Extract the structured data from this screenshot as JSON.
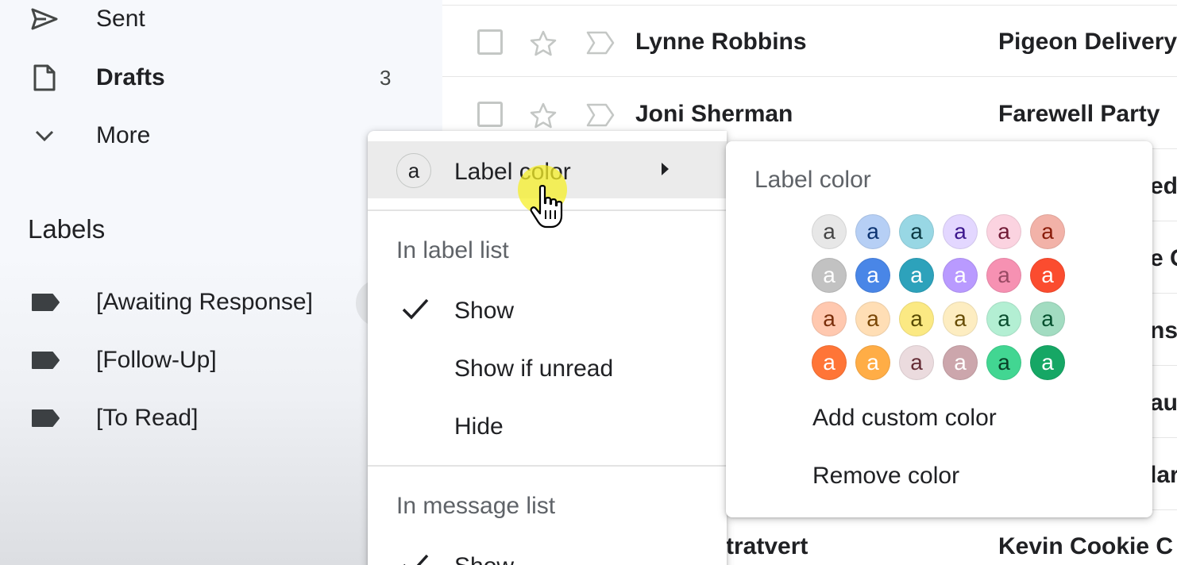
{
  "sidebar": {
    "nav": [
      {
        "label": "Sent",
        "icon": "send-icon",
        "count": ""
      },
      {
        "label": "Drafts",
        "icon": "draft-icon",
        "count": "3"
      },
      {
        "label": "More",
        "icon": "chevron-down-icon",
        "count": ""
      }
    ],
    "labels_heading": "Labels",
    "labels": [
      {
        "label": "[Awaiting Response]",
        "icon": "label-tag-icon"
      },
      {
        "label": "[Follow-Up]",
        "icon": "label-tag-icon"
      },
      {
        "label": "[To Read]",
        "icon": "label-tag-icon"
      }
    ]
  },
  "emails": [
    {
      "sender": "Lynne Robbins",
      "subject": "Pigeon Delivery"
    },
    {
      "sender": "Joni Sherman",
      "subject": "Farewell Party"
    }
  ],
  "email_partials": [
    "ed",
    "e C",
    "ns",
    "au",
    "lar"
  ],
  "email_bottom": {
    "sender_fragment": "tratvert",
    "subject_fragment": "Kevin Cookie C"
  },
  "context_menu": {
    "label_color_item": "Label color",
    "label_color_badge": "a",
    "section_label_list": "In label list",
    "label_list_options": [
      {
        "label": "Show",
        "checked": true
      },
      {
        "label": "Show if unread",
        "checked": false
      },
      {
        "label": "Hide",
        "checked": false
      }
    ],
    "section_message_list": "In message list",
    "message_list_options": [
      {
        "label": "Show",
        "checked": true
      }
    ]
  },
  "label_color_submenu": {
    "title": "Label color",
    "swatch_letter": "a",
    "swatches": [
      {
        "bg": "#e7e7e7",
        "fg": "#464646"
      },
      {
        "bg": "#b6cff5",
        "fg": "#0d3472"
      },
      {
        "bg": "#98d7e4",
        "fg": "#0d3b44"
      },
      {
        "bg": "#e3d7ff",
        "fg": "#3d188e"
      },
      {
        "bg": "#fbd3e0",
        "fg": "#711a36"
      },
      {
        "bg": "#f2b2a8",
        "fg": "#8a1c0a"
      },
      {
        "bg": "#c2c2c2",
        "fg": "#ffffff"
      },
      {
        "bg": "#4986e7",
        "fg": "#ffffff"
      },
      {
        "bg": "#2da2bb",
        "fg": "#ffffff"
      },
      {
        "bg": "#b99aff",
        "fg": "#ffffff"
      },
      {
        "bg": "#f691b2",
        "fg": "#994a64"
      },
      {
        "bg": "#fb4c2f",
        "fg": "#ffffff"
      },
      {
        "bg": "#ffc8af",
        "fg": "#7a2e0b"
      },
      {
        "bg": "#ffdeb5",
        "fg": "#7a4706"
      },
      {
        "bg": "#fbe983",
        "fg": "#594c05"
      },
      {
        "bg": "#fdedc1",
        "fg": "#684e07"
      },
      {
        "bg": "#b3efd3",
        "fg": "#0b4f30"
      },
      {
        "bg": "#a2dcc1",
        "fg": "#04502e"
      },
      {
        "bg": "#ff7537",
        "fg": "#ffffff"
      },
      {
        "bg": "#ffad46",
        "fg": "#ffffff"
      },
      {
        "bg": "#ebdbde",
        "fg": "#662e37"
      },
      {
        "bg": "#cca6ac",
        "fg": "#ffffff"
      },
      {
        "bg": "#42d692",
        "fg": "#094228"
      },
      {
        "bg": "#16a765",
        "fg": "#ffffff"
      }
    ],
    "add_custom": "Add custom color",
    "remove": "Remove color"
  }
}
